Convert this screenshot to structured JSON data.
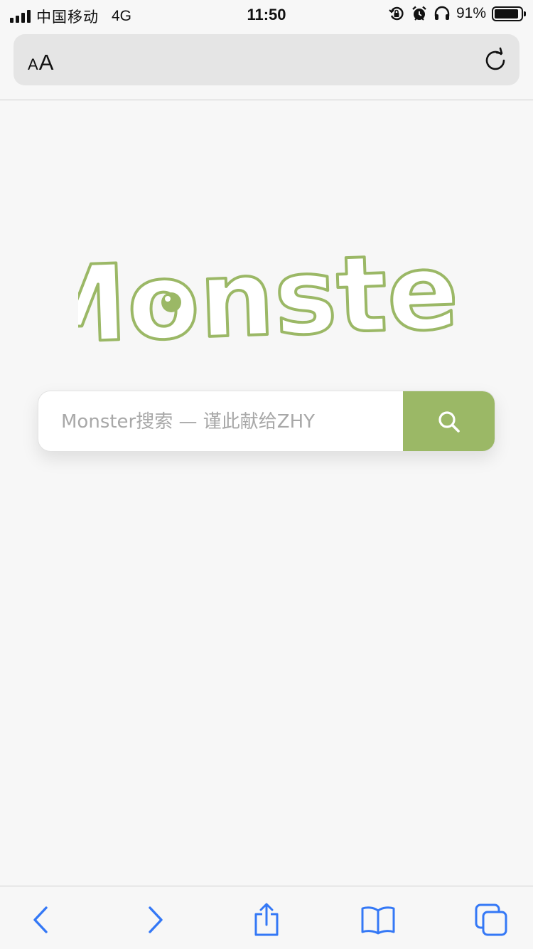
{
  "status_bar": {
    "carrier": "中国移动",
    "network": "4G",
    "time": "11:50",
    "battery_percent": "91%",
    "battery_level": 0.91,
    "icons": [
      "signal-icon",
      "orientation-lock-icon",
      "alarm-icon",
      "headphones-icon",
      "battery-icon"
    ]
  },
  "address_bar": {
    "aa_small": "A",
    "aa_large": "A",
    "icons": [
      "reload-icon"
    ]
  },
  "logo": {
    "text": "Monster",
    "color": "#9bb866"
  },
  "search": {
    "placeholder": "Monster搜索 — 谨此献给ZHY",
    "value": "",
    "button_color": "#9bb866",
    "icon": "search-icon"
  },
  "toolbar": {
    "accent_color": "#3478f6",
    "icons": [
      "back-icon",
      "forward-icon",
      "share-icon",
      "bookmarks-icon",
      "tabs-icon"
    ]
  }
}
